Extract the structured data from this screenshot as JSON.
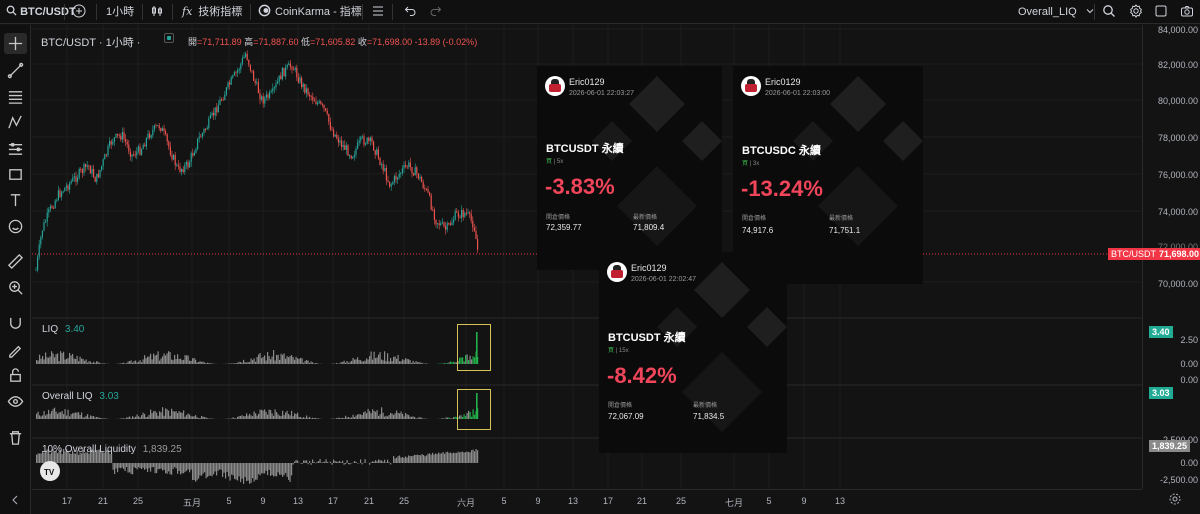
{
  "topbar": {
    "symbol": "BTC/USDT",
    "interval": "1小時",
    "indicators_label": "技術指標",
    "script_label": "CoinKarma - 指標",
    "layout_name": "Overall_LIQ"
  },
  "legend": {
    "symbol_line": "BTC/USDT · 1小時 ·",
    "open_label": "開",
    "open": "=71,711.89",
    "high_label": "高",
    "high": "=71,887.60",
    "low_label": "低",
    "low": "=71,605.82",
    "close_label": "收",
    "close": "=71,698.00",
    "change": "-13.89 (-0.02%)"
  },
  "price_axis": {
    "ticks": [
      "84,000.00",
      "82,000.00",
      "80,000.00",
      "78,000.00",
      "76,000.00",
      "74,000.00",
      "72,000.00",
      "70,000.00"
    ],
    "price_badge_symbol": "BTC/USDT",
    "price_badge_value": "71,698.00",
    "liq_ticks": [
      "2.50",
      "0.00"
    ],
    "liq_badge": "3.40",
    "overall_ticks": [
      "0.00"
    ],
    "overall_badge": "3.03",
    "liquidity_ticks": [
      "2,500.00",
      "0.00",
      "-2,500.00"
    ],
    "liquidity_badge": "1,839.25"
  },
  "panes": {
    "liq_name": "LIQ",
    "liq_value": "3.40",
    "overall_name": "Overall LIQ",
    "overall_value": "3.03",
    "liquidity_name": "10% Overall Liquidity",
    "liquidity_value": "1,839.25"
  },
  "time_axis": [
    "17",
    "21",
    "25",
    "五月",
    "5",
    "9",
    "13",
    "17",
    "21",
    "25",
    "六月",
    "5",
    "9",
    "13",
    "17",
    "21",
    "25",
    "七月",
    "5",
    "9",
    "13"
  ],
  "cards": [
    {
      "user": "Eric0129",
      "date": "2026-06-01 22:03:27",
      "pair": "BTCUSDT 永續",
      "side": "買",
      "leverage": "5x",
      "pct": "-3.83%",
      "entry_label": "開倉價格",
      "entry": "72,359.77",
      "last_label": "最新價格",
      "last": "71,809.4"
    },
    {
      "user": "Eric0129",
      "date": "2026-06-01 22:03:00",
      "pair": "BTCUSDC 永續",
      "side": "買",
      "leverage": "3x",
      "pct": "-13.24%",
      "entry_label": "開倉價格",
      "entry": "74,917.6",
      "last_label": "最新價格",
      "last": "71,751.1"
    },
    {
      "user": "Eric0129",
      "date": "2026-06-01 22:02:47",
      "pair": "BTCUSDT 永續",
      "side": "買",
      "leverage": "15x",
      "pct": "-8.42%",
      "entry_label": "開倉價格",
      "entry": "72,067.09",
      "last_label": "最新價格",
      "last": "71,834.5"
    }
  ],
  "colors": {
    "up": "#26a69a",
    "down": "#ef5350",
    "liq_bar": "#8a8a8a",
    "liq_hot": "#22b04a",
    "badge_red": "#f23645",
    "badge_green": "#22ab94"
  }
}
